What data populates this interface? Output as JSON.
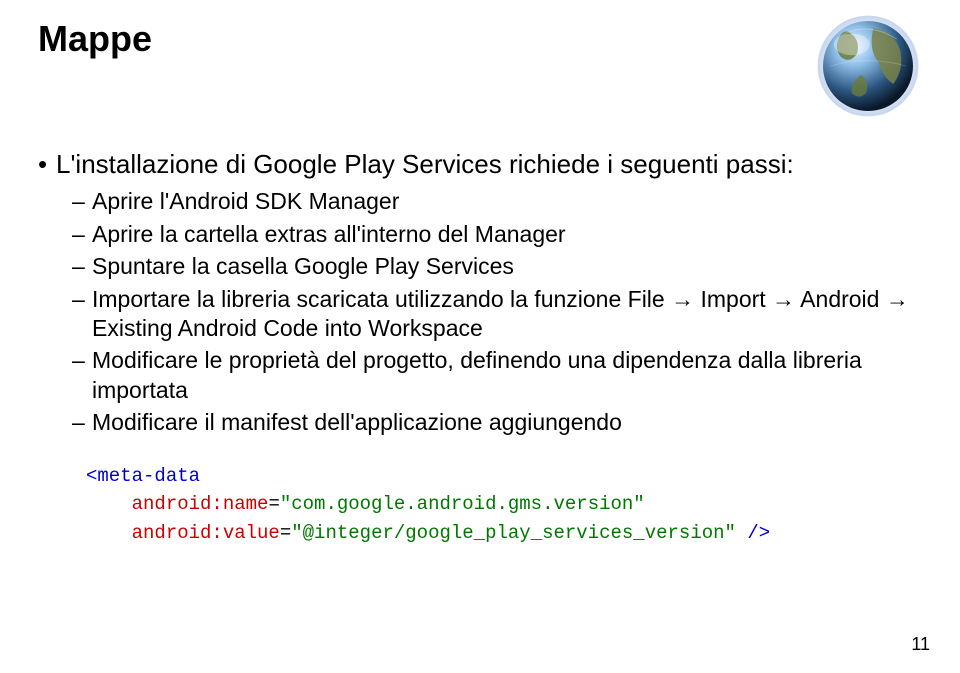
{
  "title": "Mappe",
  "intro": "L'installazione di Google Play Services richiede i seguenti passi:",
  "steps": [
    "Aprire l'Android SDK Manager",
    "Aprire la cartella extras all'interno del Manager",
    "Spuntare la casella Google Play Services",
    "Importare la libreria scaricata utilizzando la funzione File → Import → Android → Existing Android Code into Workspace",
    "Modificare le proprietà del progetto, definendo una dipendenza dalla libreria importata",
    "Modificare il manifest dell'applicazione aggiungendo"
  ],
  "code": {
    "open_tag": "<meta-data",
    "attr1_name": "android:name",
    "attr1_value": "\"com.google.android.gms.version\"",
    "attr2_name": "android:value",
    "attr2_value": "\"@integer/google_play_services_version\"",
    "close": " />"
  },
  "page_number": "11"
}
